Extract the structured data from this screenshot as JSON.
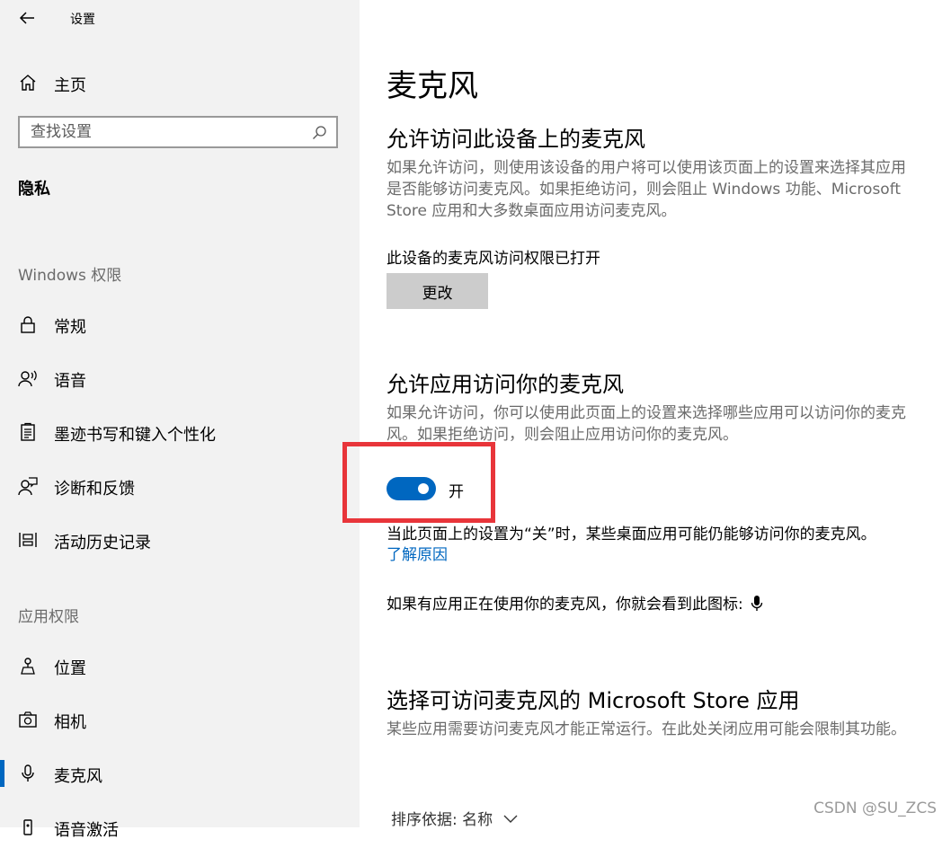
{
  "window": {
    "title": "设置"
  },
  "sidebar": {
    "home_label": "主页",
    "search_placeholder": "查找设置",
    "section_title": "隐私",
    "groups": [
      {
        "header": "Windows 权限",
        "items": [
          {
            "label": "常规",
            "icon": "lock-icon"
          },
          {
            "label": "语音",
            "icon": "speech-icon"
          },
          {
            "label": "墨迹书写和键入个性化",
            "icon": "clipboard-icon"
          },
          {
            "label": "诊断和反馈",
            "icon": "person-feedback-icon"
          },
          {
            "label": "活动历史记录",
            "icon": "timeline-icon"
          }
        ]
      },
      {
        "header": "应用权限",
        "items": [
          {
            "label": "位置",
            "icon": "location-person-icon"
          },
          {
            "label": "相机",
            "icon": "camera-icon"
          },
          {
            "label": "麦克风",
            "icon": "microphone-icon",
            "active": true
          },
          {
            "label": "语音激活",
            "icon": "device-icon"
          }
        ]
      }
    ]
  },
  "main": {
    "title": "麦克风",
    "device_section": {
      "heading": "允许访问此设备上的麦克风",
      "description": "如果允许访问，则使用该设备的用户将可以使用该页面上的设置来选择其应用是否能够访问麦克风。如果拒绝访问，则会阻止 Windows 功能、Microsoft Store 应用和大多数桌面应用访问麦克风。",
      "status": "此设备的麦克风访问权限已打开",
      "change_label": "更改"
    },
    "apps_section": {
      "heading": "允许应用访问你的麦克风",
      "description": "如果允许访问，你可以使用此页面上的设置来选择哪些应用可以访问你的麦克风。如果拒绝访问，则会阻止应用访问你的麦克风。",
      "toggle_state": "开",
      "toggle_on": true,
      "note": "当此页面上的设置为“关”时，某些桌面应用可能仍能够访问你的麦克风。",
      "link": "了解原因",
      "icon_note": "如果有应用正在使用你的麦克风，你就会看到此图标:"
    },
    "store_section": {
      "heading": "选择可访问麦克风的 Microsoft Store 应用",
      "description": "某些应用需要访问麦克风才能正常运行。在此处关闭应用可能会限制其功能。",
      "sort_label": "排序依据: 名称"
    }
  },
  "watermark": "CSDN @SU_ZCS",
  "colors": {
    "accent": "#0067c0",
    "highlight": "#e8353a",
    "sidebar_bg": "#f2f2f2"
  }
}
